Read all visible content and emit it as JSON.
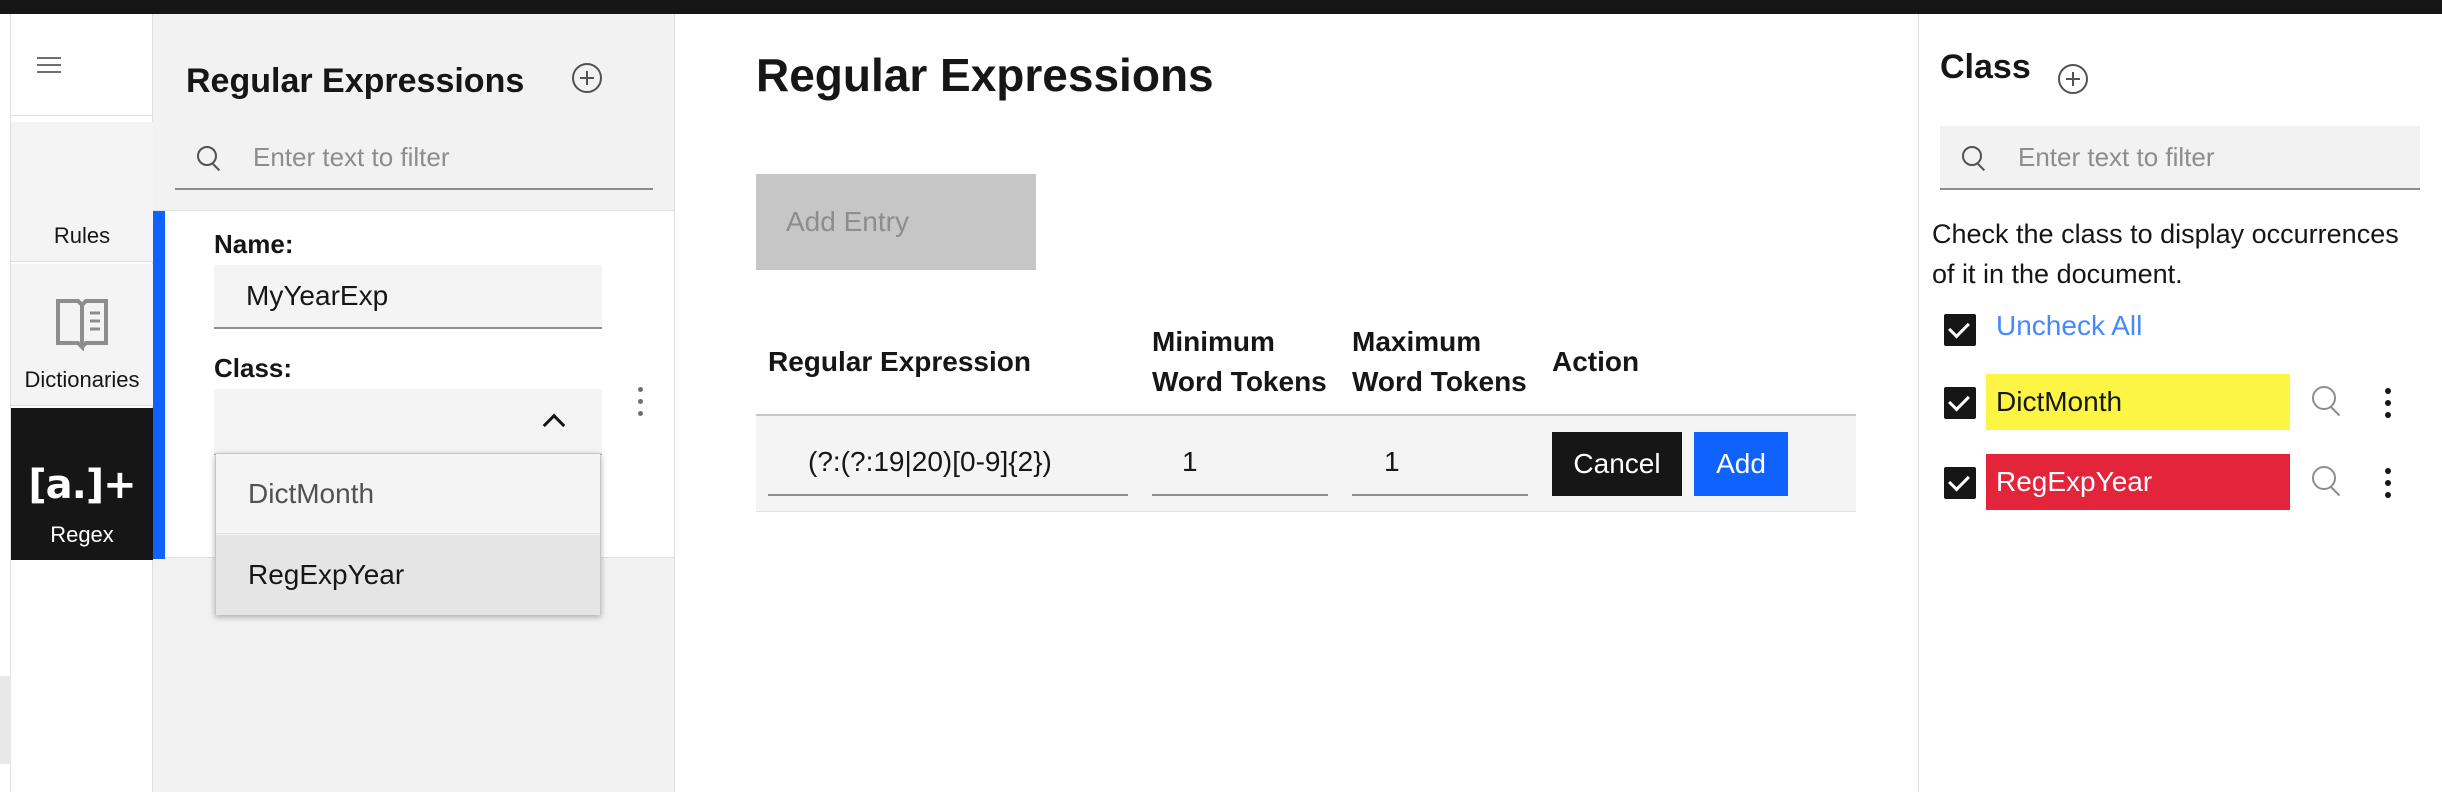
{
  "rail": {
    "items": [
      {
        "label": "Rules"
      },
      {
        "label": "Dictionaries"
      },
      {
        "label": "Regex",
        "glyph": "[a.]+"
      }
    ]
  },
  "left_panel": {
    "title": "Regular Expressions",
    "search_placeholder": "Enter text to filter",
    "edit": {
      "name_label": "Name:",
      "name_value": "MyYearExp",
      "class_label": "Class:",
      "class_value": "",
      "class_options": [
        "DictMonth",
        "RegExpYear"
      ]
    }
  },
  "main": {
    "title": "Regular Expressions",
    "add_entry_label": "Add Entry",
    "columns": {
      "regex": "Regular Expression",
      "min_line1": "Minimum",
      "min_line2": "Word Tokens",
      "max_line1": "Maximum",
      "max_line2": "Word Tokens",
      "action": "Action"
    },
    "row": {
      "regex": "(?:(?:19|20)[0-9]{2})",
      "min": "1",
      "max": "1",
      "cancel_label": "Cancel",
      "add_label": "Add"
    }
  },
  "right_panel": {
    "title": "Class",
    "search_placeholder": "Enter text to filter",
    "help_text": "Check the class to display occurrences of it in the document.",
    "uncheck_all_label": "Uncheck All",
    "classes": [
      {
        "name": "DictMonth",
        "color": "#fdf543",
        "text_color": "#161616"
      },
      {
        "name": "RegExpYear",
        "color": "#e3243b",
        "text_color": "#ffffff"
      }
    ]
  },
  "colors": {
    "accent": "#0f62fe",
    "link": "#4589ff",
    "dark": "#161616"
  }
}
